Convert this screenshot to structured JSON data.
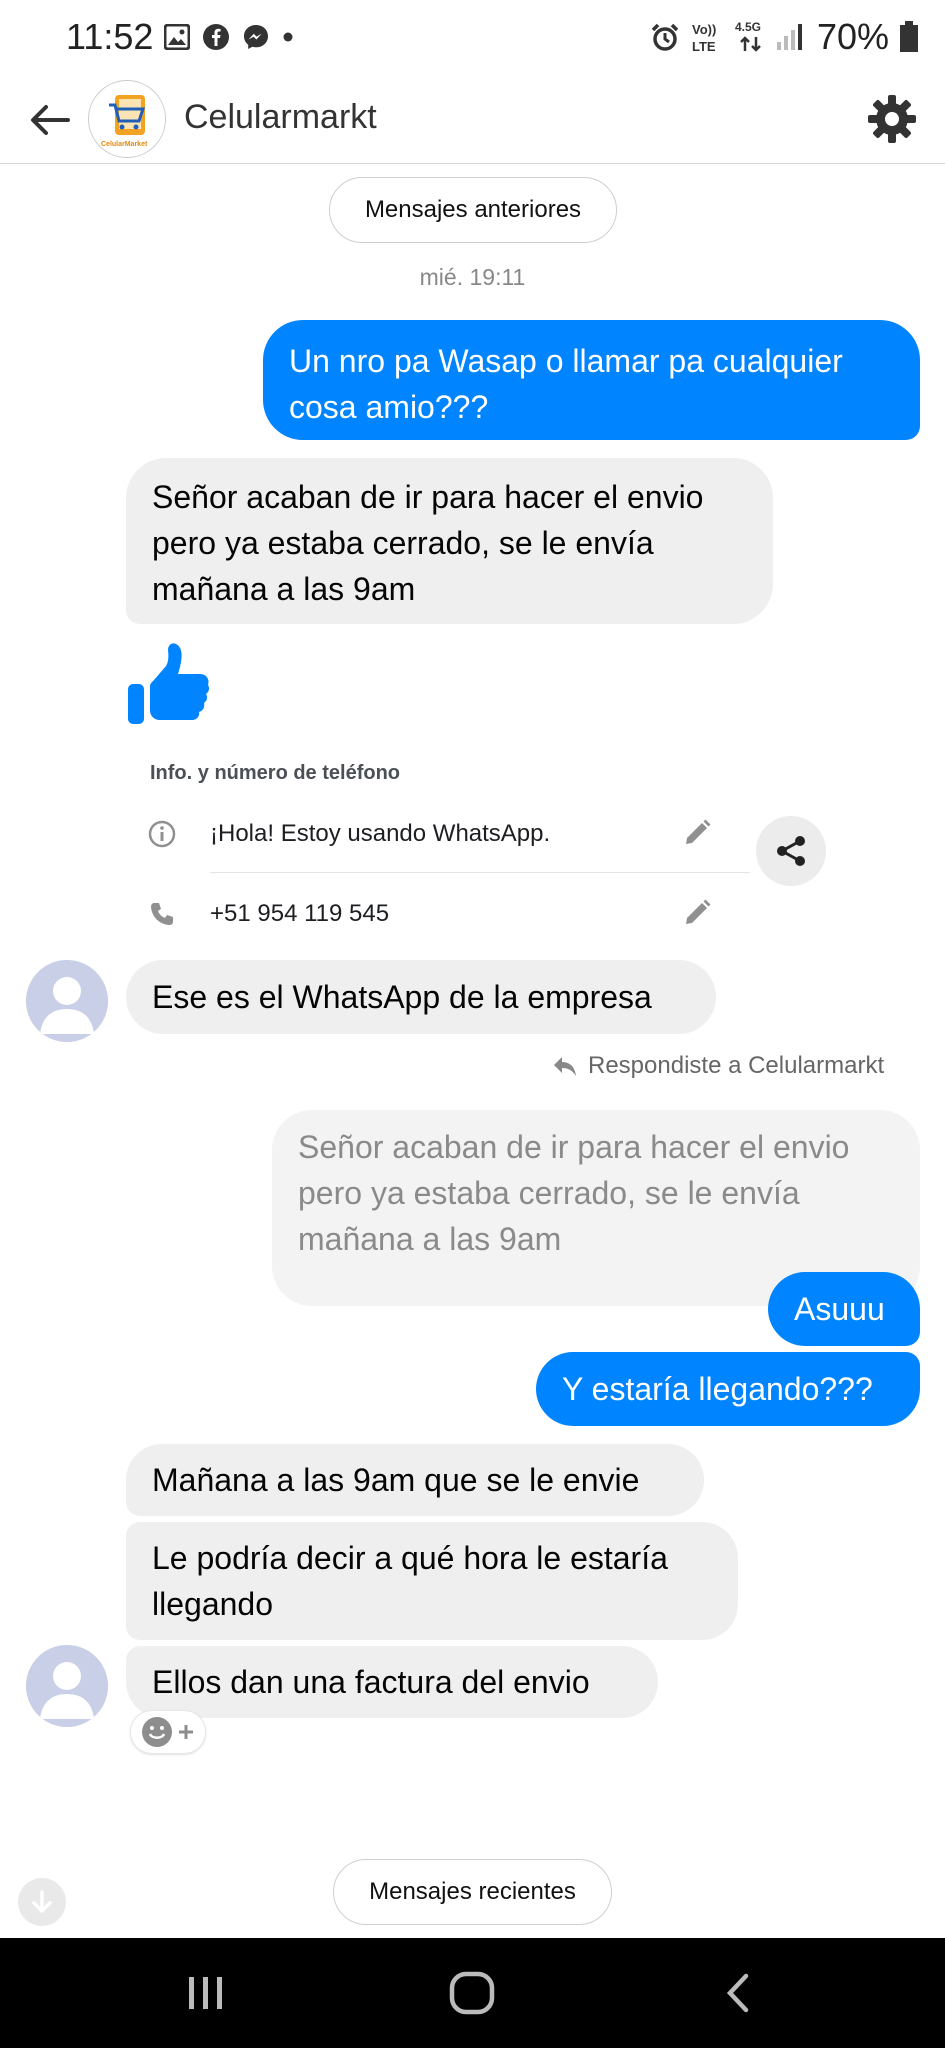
{
  "status_bar": {
    "time": "11:52",
    "battery": "70%",
    "network": "4.5G"
  },
  "header": {
    "page_name": "Celularmarkt",
    "logo_text": "CelularMarket"
  },
  "conversation": {
    "older_messages_label": "Mensajes anteriores",
    "timestamp": "mié. 19:11",
    "messages": [
      {
        "side": "out",
        "text": "Un nro pa Wasap o llamar pa cualquier cosa amio???"
      },
      {
        "side": "in",
        "text": "Señor acaban de ir para hacer el envio pero ya estaba cerrado, se le envía mañana a las 9am"
      },
      {
        "side": "in",
        "text": "Ese es el WhatsApp de la empresa"
      },
      {
        "side": "out",
        "text": "Asuuu"
      },
      {
        "side": "out",
        "text": "Y estaría llegando???"
      },
      {
        "side": "in",
        "text": "Mañana a las 9am que se le envie"
      },
      {
        "side": "in",
        "text": "Le podría decir a qué hora le estaría llegando"
      },
      {
        "side": "in",
        "text": "Ellos dan una factura del envio"
      }
    ],
    "contact_card": {
      "title": "Info. y número de teléfono",
      "status": "¡Hola! Estoy usando WhatsApp.",
      "phone": "+51 954 119 545"
    },
    "reply": {
      "label": "Respondiste a Celularmarkt",
      "quoted_text": "Señor acaban de ir para hacer el envio pero ya estaba cerrado, se le envía mañana a las 9am"
    },
    "recent_messages_label": "Mensajes recientes"
  },
  "colors": {
    "outgoing_bubble": "#0084ff",
    "incoming_bubble": "#efefef",
    "quoted_bubble": "#f3f3f3",
    "nav_bar": "#000000"
  }
}
